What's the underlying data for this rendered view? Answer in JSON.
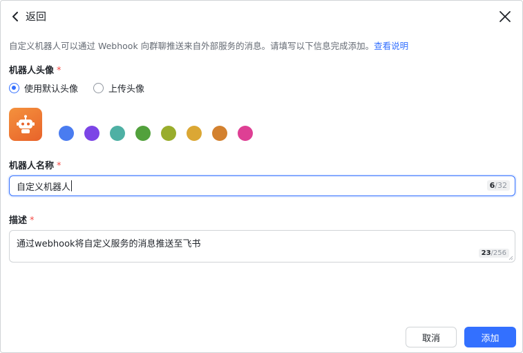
{
  "header": {
    "back_label": "返回"
  },
  "intro": {
    "text": "自定义机器人可以通过 Webhook 向群聊推送来自外部服务的消息。请填写以下信息完成添加。",
    "link": "查看说明"
  },
  "avatar_section": {
    "label": "机器人头像",
    "required_mark": "*",
    "options": [
      {
        "label": "使用默认头像",
        "selected": true
      },
      {
        "label": "上传头像",
        "selected": false
      }
    ],
    "colors": [
      "#4a7cf0",
      "#7c45e6",
      "#4eb0a4",
      "#52a13c",
      "#99ad2c",
      "#dba734",
      "#d3812f",
      "#de3f94"
    ],
    "avatar_icon": "robot-icon"
  },
  "name_section": {
    "label": "机器人名称",
    "required_mark": "*",
    "value": "自定义机器人",
    "count_current": "6",
    "count_max": "/32"
  },
  "desc_section": {
    "label": "描述",
    "required_mark": "*",
    "value": "通过webhook将自定义服务的消息推送至飞书",
    "count_current": "23",
    "count_max": "/256"
  },
  "footer": {
    "cancel_label": "取消",
    "add_label": "添加"
  },
  "colors": {
    "accent": "#3370ff",
    "required": "#f54a45"
  },
  "icons": {
    "back": "chevron-left-icon",
    "close": "close-icon"
  }
}
